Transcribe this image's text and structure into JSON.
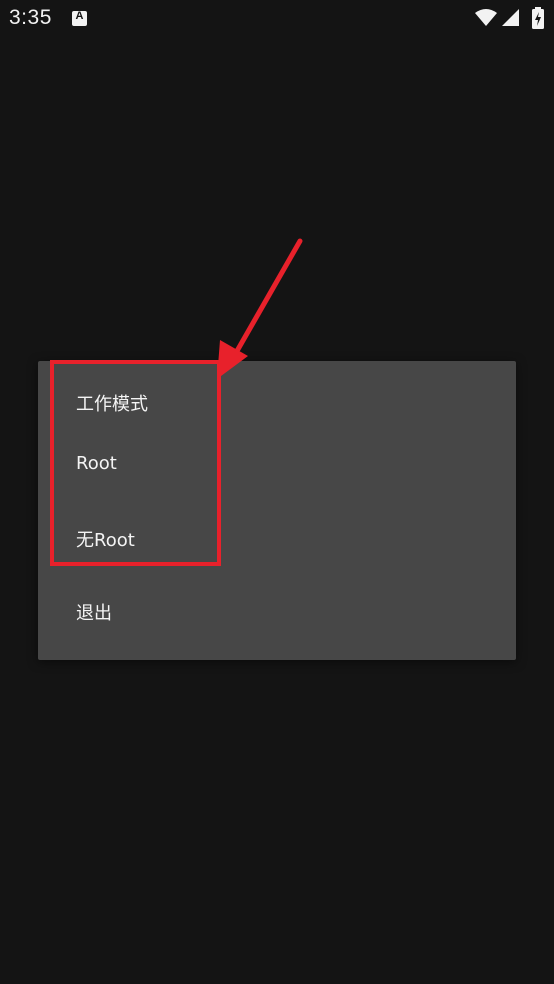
{
  "status_bar": {
    "time": "3:35",
    "notification_icon": "A",
    "icons": [
      "wifi-icon",
      "signal-icon",
      "battery-charging-icon"
    ]
  },
  "dialog": {
    "title": "工作模式",
    "items": [
      {
        "label": "Root"
      },
      {
        "label": "无Root"
      },
      {
        "label": "退出"
      }
    ]
  },
  "annotation": {
    "color": "#e8212b"
  },
  "colors": {
    "background": "#141414",
    "dialog": "#474747",
    "text": "#f4f4f4"
  }
}
